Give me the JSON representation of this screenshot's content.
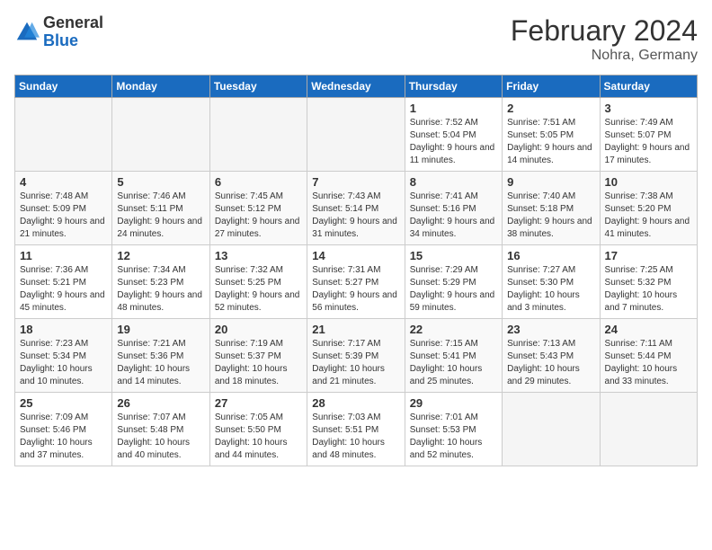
{
  "header": {
    "logo_general": "General",
    "logo_blue": "Blue",
    "month_title": "February 2024",
    "location": "Nohra, Germany"
  },
  "weekdays": [
    "Sunday",
    "Monday",
    "Tuesday",
    "Wednesday",
    "Thursday",
    "Friday",
    "Saturday"
  ],
  "weeks": [
    [
      {
        "day": "",
        "empty": true
      },
      {
        "day": "",
        "empty": true
      },
      {
        "day": "",
        "empty": true
      },
      {
        "day": "",
        "empty": true
      },
      {
        "day": "1",
        "sunrise": "7:52 AM",
        "sunset": "5:04 PM",
        "daylight": "9 hours and 11 minutes."
      },
      {
        "day": "2",
        "sunrise": "7:51 AM",
        "sunset": "5:05 PM",
        "daylight": "9 hours and 14 minutes."
      },
      {
        "day": "3",
        "sunrise": "7:49 AM",
        "sunset": "5:07 PM",
        "daylight": "9 hours and 17 minutes."
      }
    ],
    [
      {
        "day": "4",
        "sunrise": "7:48 AM",
        "sunset": "5:09 PM",
        "daylight": "9 hours and 21 minutes."
      },
      {
        "day": "5",
        "sunrise": "7:46 AM",
        "sunset": "5:11 PM",
        "daylight": "9 hours and 24 minutes."
      },
      {
        "day": "6",
        "sunrise": "7:45 AM",
        "sunset": "5:12 PM",
        "daylight": "9 hours and 27 minutes."
      },
      {
        "day": "7",
        "sunrise": "7:43 AM",
        "sunset": "5:14 PM",
        "daylight": "9 hours and 31 minutes."
      },
      {
        "day": "8",
        "sunrise": "7:41 AM",
        "sunset": "5:16 PM",
        "daylight": "9 hours and 34 minutes."
      },
      {
        "day": "9",
        "sunrise": "7:40 AM",
        "sunset": "5:18 PM",
        "daylight": "9 hours and 38 minutes."
      },
      {
        "day": "10",
        "sunrise": "7:38 AM",
        "sunset": "5:20 PM",
        "daylight": "9 hours and 41 minutes."
      }
    ],
    [
      {
        "day": "11",
        "sunrise": "7:36 AM",
        "sunset": "5:21 PM",
        "daylight": "9 hours and 45 minutes."
      },
      {
        "day": "12",
        "sunrise": "7:34 AM",
        "sunset": "5:23 PM",
        "daylight": "9 hours and 48 minutes."
      },
      {
        "day": "13",
        "sunrise": "7:32 AM",
        "sunset": "5:25 PM",
        "daylight": "9 hours and 52 minutes."
      },
      {
        "day": "14",
        "sunrise": "7:31 AM",
        "sunset": "5:27 PM",
        "daylight": "9 hours and 56 minutes."
      },
      {
        "day": "15",
        "sunrise": "7:29 AM",
        "sunset": "5:29 PM",
        "daylight": "9 hours and 59 minutes."
      },
      {
        "day": "16",
        "sunrise": "7:27 AM",
        "sunset": "5:30 PM",
        "daylight": "10 hours and 3 minutes."
      },
      {
        "day": "17",
        "sunrise": "7:25 AM",
        "sunset": "5:32 PM",
        "daylight": "10 hours and 7 minutes."
      }
    ],
    [
      {
        "day": "18",
        "sunrise": "7:23 AM",
        "sunset": "5:34 PM",
        "daylight": "10 hours and 10 minutes."
      },
      {
        "day": "19",
        "sunrise": "7:21 AM",
        "sunset": "5:36 PM",
        "daylight": "10 hours and 14 minutes."
      },
      {
        "day": "20",
        "sunrise": "7:19 AM",
        "sunset": "5:37 PM",
        "daylight": "10 hours and 18 minutes."
      },
      {
        "day": "21",
        "sunrise": "7:17 AM",
        "sunset": "5:39 PM",
        "daylight": "10 hours and 21 minutes."
      },
      {
        "day": "22",
        "sunrise": "7:15 AM",
        "sunset": "5:41 PM",
        "daylight": "10 hours and 25 minutes."
      },
      {
        "day": "23",
        "sunrise": "7:13 AM",
        "sunset": "5:43 PM",
        "daylight": "10 hours and 29 minutes."
      },
      {
        "day": "24",
        "sunrise": "7:11 AM",
        "sunset": "5:44 PM",
        "daylight": "10 hours and 33 minutes."
      }
    ],
    [
      {
        "day": "25",
        "sunrise": "7:09 AM",
        "sunset": "5:46 PM",
        "daylight": "10 hours and 37 minutes."
      },
      {
        "day": "26",
        "sunrise": "7:07 AM",
        "sunset": "5:48 PM",
        "daylight": "10 hours and 40 minutes."
      },
      {
        "day": "27",
        "sunrise": "7:05 AM",
        "sunset": "5:50 PM",
        "daylight": "10 hours and 44 minutes."
      },
      {
        "day": "28",
        "sunrise": "7:03 AM",
        "sunset": "5:51 PM",
        "daylight": "10 hours and 48 minutes."
      },
      {
        "day": "29",
        "sunrise": "7:01 AM",
        "sunset": "5:53 PM",
        "daylight": "10 hours and 52 minutes."
      },
      {
        "day": "",
        "empty": true
      },
      {
        "day": "",
        "empty": true
      }
    ]
  ]
}
